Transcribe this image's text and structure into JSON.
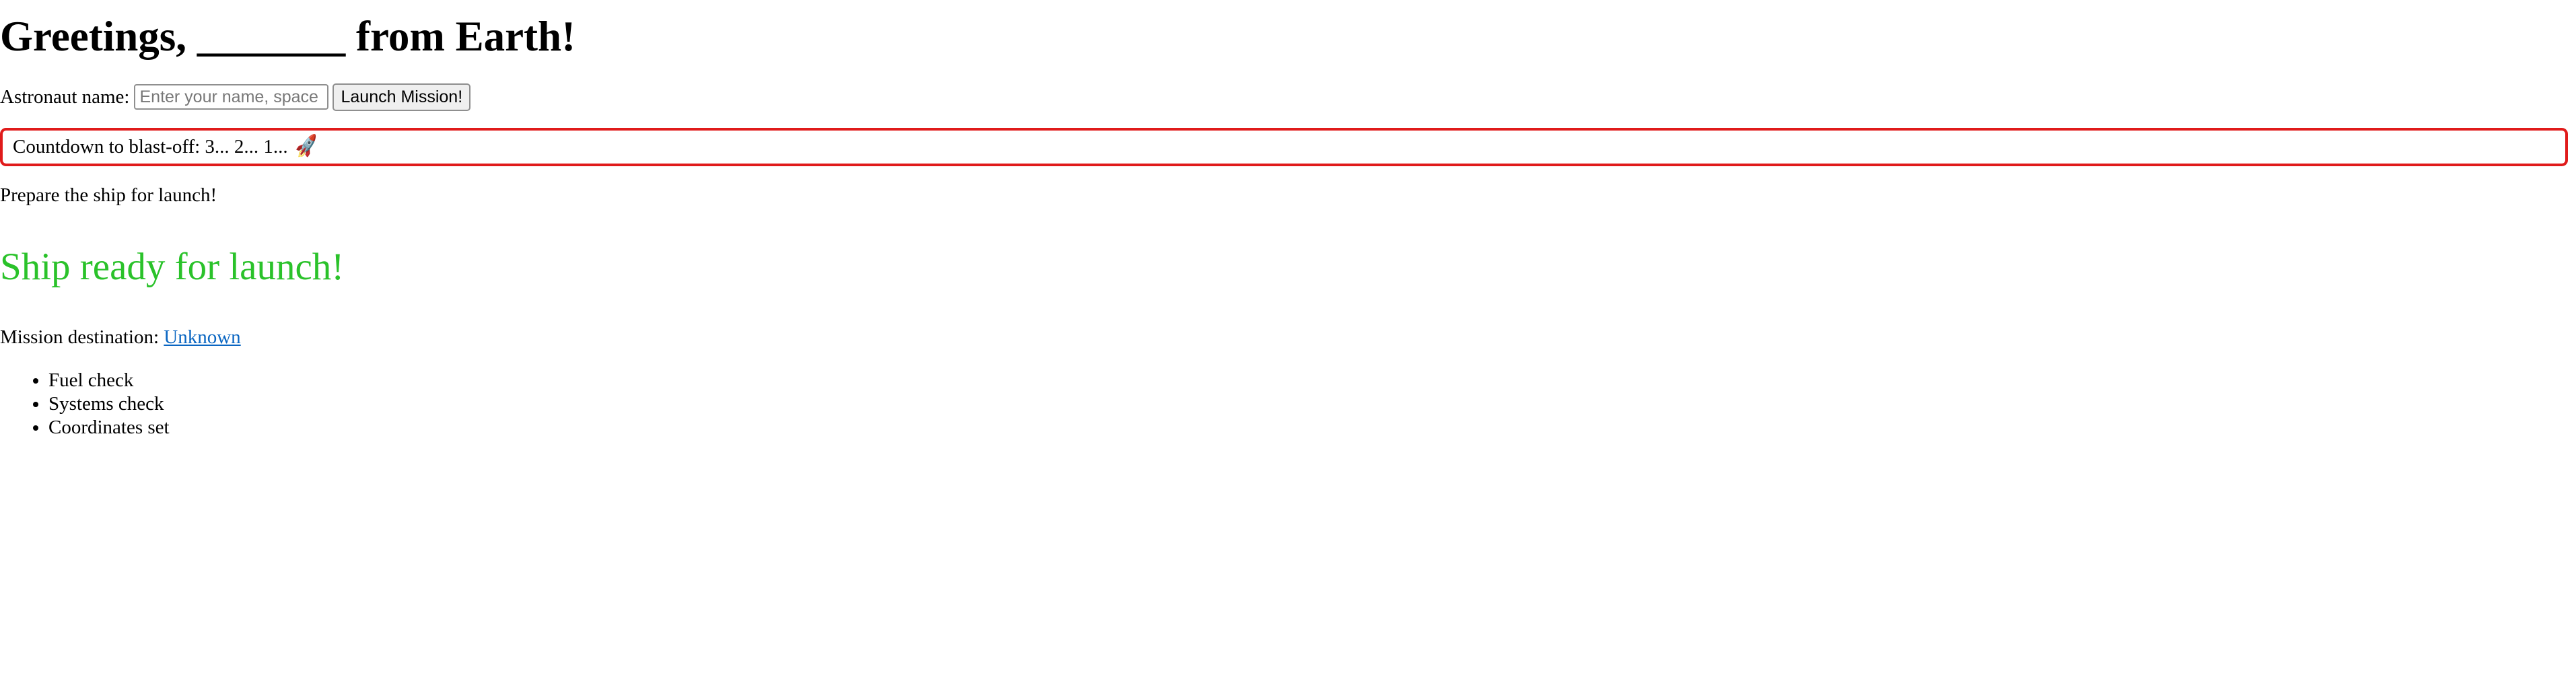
{
  "heading": {
    "text": "Greetings, _______ from Earth!"
  },
  "name_form": {
    "label": "Astronaut name:",
    "input_value": "",
    "input_placeholder": "Enter your name, space traveler",
    "button_label": "Launch Mission!"
  },
  "countdown": {
    "text": "Countdown to blast-off: 3... 2... 1...",
    "icon": "rocket-icon",
    "icon_glyph": "🚀",
    "border_color": "#e01b1b"
  },
  "prepare_text": "Prepare the ship for launch!",
  "status": {
    "text": "Ship ready for launch!",
    "color": "#2ac22a"
  },
  "destination": {
    "label": "Mission destination:",
    "link_text": "Unknown",
    "link_color": "#0a66c2"
  },
  "checklist": [
    "Fuel check",
    "Systems check",
    "Coordinates set"
  ]
}
